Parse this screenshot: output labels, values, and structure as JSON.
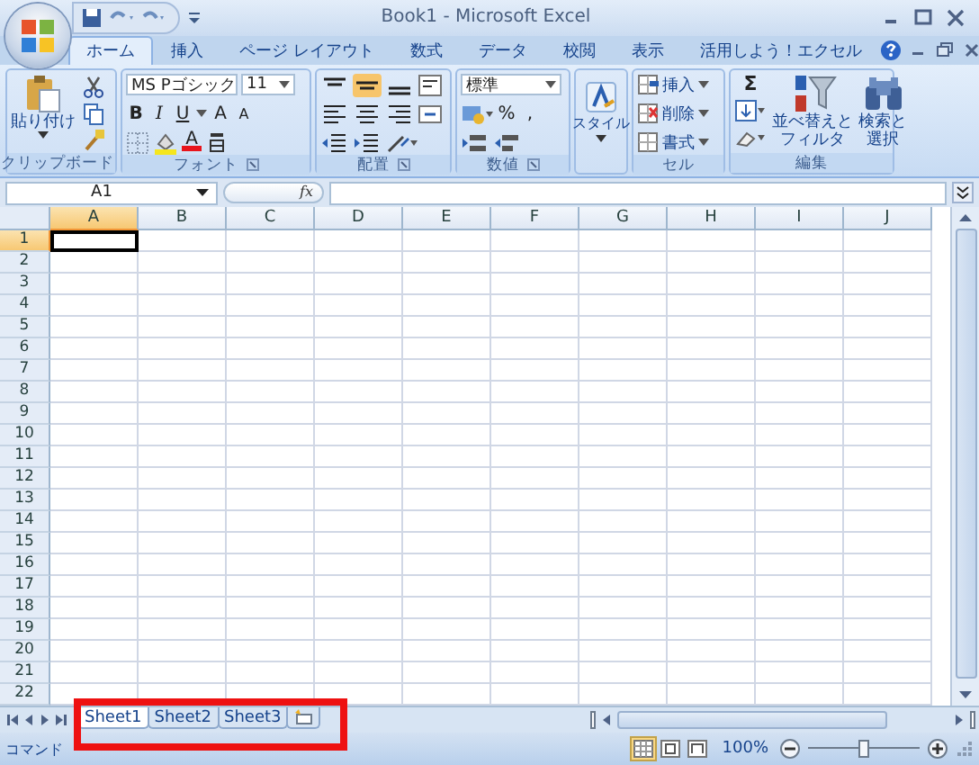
{
  "window": {
    "title": "Book1 - Microsoft Excel"
  },
  "tabs": [
    {
      "label": "ホーム",
      "selected": true
    },
    {
      "label": "挿入",
      "selected": false
    },
    {
      "label": "ページ レイアウト",
      "selected": false
    },
    {
      "label": "数式",
      "selected": false
    },
    {
      "label": "データ",
      "selected": false
    },
    {
      "label": "校閲",
      "selected": false
    },
    {
      "label": "表示",
      "selected": false
    },
    {
      "label": "活用しよう！エクセル",
      "selected": false
    }
  ],
  "ribbon": {
    "groups": [
      {
        "kind": "clipboard",
        "label": "クリップボード",
        "paste": "貼り付け"
      },
      {
        "kind": "font",
        "label": "フォント",
        "font_name": "MS Pゴシック",
        "font_size": "11",
        "bold": "B",
        "italic": "I",
        "underline": "U",
        "grow": "A",
        "shrink": "A",
        "font_color": "A"
      },
      {
        "kind": "alignment",
        "label": "配置"
      },
      {
        "kind": "number",
        "label": "数値",
        "format": "標準",
        "percent": "%",
        "comma": ","
      },
      {
        "kind": "styles",
        "button": "スタイル"
      },
      {
        "kind": "cells",
        "label": "セル",
        "buttons": [
          "挿入",
          "削除",
          "書式"
        ]
      },
      {
        "kind": "editing",
        "label": "編集",
        "sum": "Σ",
        "sort": [
          "並べ替えと",
          "フィルタ"
        ],
        "find": [
          "検索と",
          "選択"
        ]
      }
    ]
  },
  "formula_bar": {
    "name_box": "A1",
    "fx": "fx"
  },
  "sheet": {
    "columns": [
      {
        "label": "A",
        "selected": true
      },
      {
        "label": "B",
        "selected": false
      },
      {
        "label": "C",
        "selected": false
      },
      {
        "label": "D",
        "selected": false
      },
      {
        "label": "E",
        "selected": false
      },
      {
        "label": "F",
        "selected": false
      },
      {
        "label": "G",
        "selected": false
      },
      {
        "label": "H",
        "selected": false
      },
      {
        "label": "I",
        "selected": false
      },
      {
        "label": "J",
        "selected": false
      }
    ],
    "rows": [
      {
        "label": "1",
        "selected": true
      },
      {
        "label": "2",
        "selected": false
      },
      {
        "label": "3",
        "selected": false
      },
      {
        "label": "4",
        "selected": false
      },
      {
        "label": "5",
        "selected": false
      },
      {
        "label": "6",
        "selected": false
      },
      {
        "label": "7",
        "selected": false
      },
      {
        "label": "8",
        "selected": false
      },
      {
        "label": "9",
        "selected": false
      },
      {
        "label": "10",
        "selected": false
      },
      {
        "label": "11",
        "selected": false
      },
      {
        "label": "12",
        "selected": false
      },
      {
        "label": "13",
        "selected": false
      },
      {
        "label": "14",
        "selected": false
      },
      {
        "label": "15",
        "selected": false
      },
      {
        "label": "16",
        "selected": false
      },
      {
        "label": "17",
        "selected": false
      },
      {
        "label": "18",
        "selected": false
      },
      {
        "label": "19",
        "selected": false
      },
      {
        "label": "20",
        "selected": false
      },
      {
        "label": "21",
        "selected": false
      },
      {
        "label": "22",
        "selected": false
      }
    ]
  },
  "sheet_tabs": [
    {
      "label": "Sheet1",
      "selected": true
    },
    {
      "label": "Sheet2",
      "selected": false
    },
    {
      "label": "Sheet3",
      "selected": false
    }
  ],
  "status_bar": {
    "mode": "コマンド",
    "zoom": "100%",
    "zoom_slider": {
      "level": 0.5
    },
    "views": [
      {
        "kind": "normal",
        "selected": true
      },
      {
        "kind": "layout",
        "selected": false
      },
      {
        "kind": "pagebreak",
        "selected": false
      }
    ]
  }
}
